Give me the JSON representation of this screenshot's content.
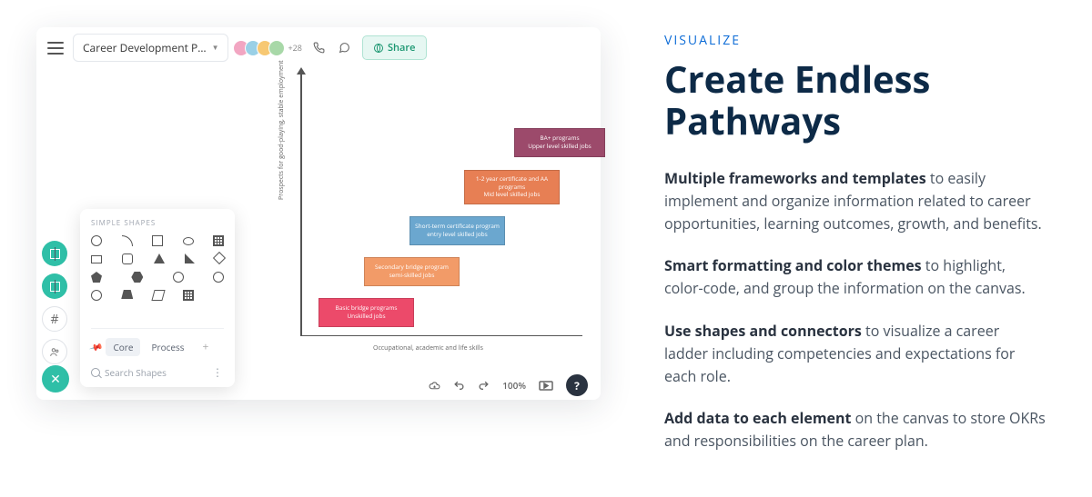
{
  "marketing": {
    "eyebrow": "VISUALIZE",
    "heading": "Create Endless Pathways",
    "p1_bold": "Multiple frameworks and templates",
    "p1_rest": " to easily implement and organize information related to career opportunities, learning outcomes, growth, and benefits.",
    "p2_bold": "Smart formatting and color themes",
    "p2_rest": " to highlight, color-code, and group the information on the canvas.",
    "p3_bold": "Use shapes and connectors",
    "p3_rest": " to visualize a career ladder including competencies and expectations for each role.",
    "p4_bold": "Add data to each element",
    "p4_rest": " on the canvas to store OKRs and responsibilities on the career plan."
  },
  "app": {
    "doc_title": "Career Development P…",
    "avatar_extra": "+28",
    "share_label": "Share",
    "axis": {
      "ylabel": "Prospects   for  good-playing,    stable   employment",
      "xlabel": "Occupational,     academic    and   life  skills"
    },
    "steps": {
      "s1l1": "Basic   bridge    programs",
      "s1l2": "Unskilled   jobs",
      "s2l1": "Secondary    bridge    program",
      "s2l2": "semi-skilled    jobs",
      "s3l1": "Short-term     certificate    program",
      "s3l2": "entry   level   skilled   jobs",
      "s4l1": "1-2   year   certificate     and  AA",
      "s4l2": "programs",
      "s4l3": "Mid   level   skilled   jobs",
      "s5l1": "BA+  programs",
      "s5l2": "Upper   level    skilled    jobs"
    },
    "shapes_panel": {
      "title": "SIMPLE SHAPES",
      "tab_core": "Core",
      "tab_process": "Process",
      "search_placeholder": "Search Shapes"
    },
    "bottom": {
      "zoom": "100%",
      "help": "?"
    }
  }
}
